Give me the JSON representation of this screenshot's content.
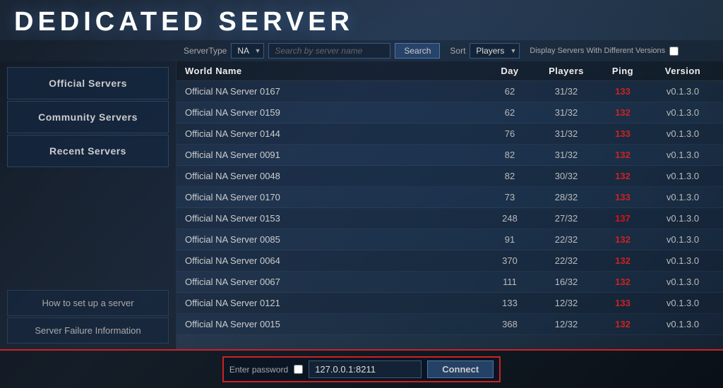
{
  "app": {
    "title": "DEDICATED SERVER"
  },
  "toolbar": {
    "server_type_label": "ServerType",
    "server_type_value": "NA",
    "search_placeholder": "Search by server name",
    "search_button": "Search",
    "sort_label": "Sort",
    "sort_value": "Players",
    "display_diff_label": "Display Servers With Different Versions"
  },
  "sidebar": {
    "nav_items": [
      {
        "label": "Official Servers",
        "id": "official"
      },
      {
        "label": "Community Servers",
        "id": "community"
      },
      {
        "label": "Recent Servers",
        "id": "recent"
      }
    ],
    "bottom_items": [
      {
        "label": "How to set up a server",
        "id": "howto"
      },
      {
        "label": "Server Failure Information",
        "id": "failure"
      }
    ]
  },
  "table": {
    "headers": {
      "world_name": "World Name",
      "day": "Day",
      "players": "Players",
      "ping": "Ping",
      "version": "Version"
    },
    "rows": [
      {
        "name": "Official NA Server 0167",
        "day": "62",
        "players": "31/32",
        "ping": "133",
        "version": "v0.1.3.0",
        "ping_class": "ping-high"
      },
      {
        "name": "Official NA Server 0159",
        "day": "62",
        "players": "31/32",
        "ping": "132",
        "version": "v0.1.3.0",
        "ping_class": "ping-high"
      },
      {
        "name": "Official NA Server 0144",
        "day": "76",
        "players": "31/32",
        "ping": "133",
        "version": "v0.1.3.0",
        "ping_class": "ping-high"
      },
      {
        "name": "Official NA Server 0091",
        "day": "82",
        "players": "31/32",
        "ping": "132",
        "version": "v0.1.3.0",
        "ping_class": "ping-high"
      },
      {
        "name": "Official NA Server 0048",
        "day": "82",
        "players": "30/32",
        "ping": "132",
        "version": "v0.1.3.0",
        "ping_class": "ping-high"
      },
      {
        "name": "Official NA Server 0170",
        "day": "73",
        "players": "28/32",
        "ping": "133",
        "version": "v0.1.3.0",
        "ping_class": "ping-high"
      },
      {
        "name": "Official NA Server 0153",
        "day": "248",
        "players": "27/32",
        "ping": "137",
        "version": "v0.1.3.0",
        "ping_class": "ping-very-high"
      },
      {
        "name": "Official NA Server 0085",
        "day": "91",
        "players": "22/32",
        "ping": "132",
        "version": "v0.1.3.0",
        "ping_class": "ping-high"
      },
      {
        "name": "Official NA Server 0064",
        "day": "370",
        "players": "22/32",
        "ping": "132",
        "version": "v0.1.3.0",
        "ping_class": "ping-high"
      },
      {
        "name": "Official NA Server 0067",
        "day": "111",
        "players": "16/32",
        "ping": "132",
        "version": "v0.1.3.0",
        "ping_class": "ping-high"
      },
      {
        "name": "Official NA Server 0121",
        "day": "133",
        "players": "12/32",
        "ping": "133",
        "version": "v0.1.3.0",
        "ping_class": "ping-high"
      },
      {
        "name": "Official NA Server 0015",
        "day": "368",
        "players": "12/32",
        "ping": "132",
        "version": "v0.1.3.0",
        "ping_class": "ping-high"
      }
    ]
  },
  "bottom": {
    "password_label": "Enter password",
    "ip_value": "127.0.0.1:8211",
    "connect_button": "Connect"
  }
}
